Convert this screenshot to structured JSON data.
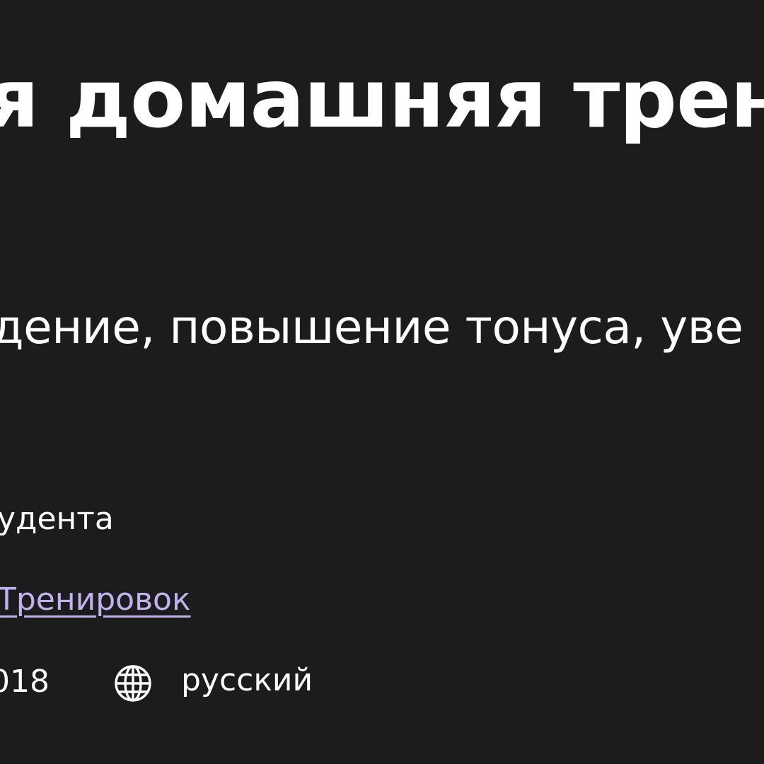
{
  "course": {
    "title": "я домашняя трен",
    "subtitle": "дение, повышение тонуса, уве"
  },
  "meta": {
    "students": "удента",
    "author_link": "Тренировок",
    "year": "018",
    "language_icon": "globe-icon",
    "language": "русский"
  },
  "colors": {
    "background": "#1c1c1d",
    "text": "#ffffff",
    "link": "#c1b2ee"
  }
}
